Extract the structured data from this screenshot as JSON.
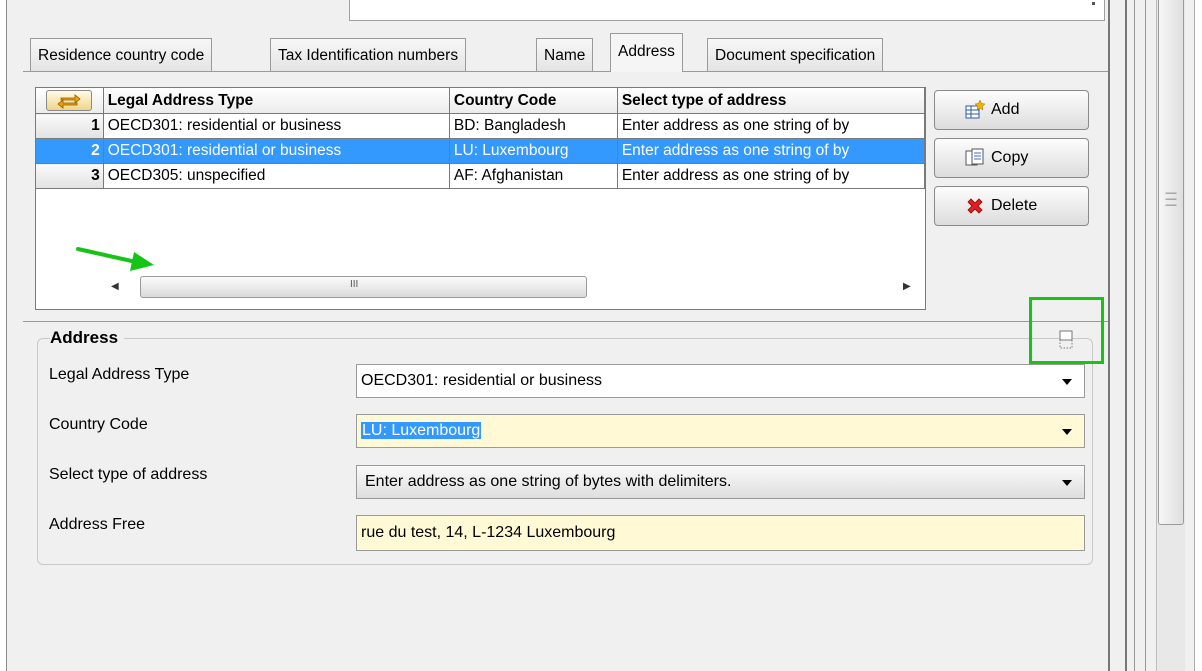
{
  "tabs": [
    {
      "label": "Residence country code"
    },
    {
      "label": "Tax Identification numbers"
    },
    {
      "label": "Name"
    },
    {
      "label": "Address"
    },
    {
      "label": "Document specification"
    }
  ],
  "active_tab": "Address",
  "table": {
    "columns": [
      "Legal Address Type",
      "Country Code",
      "Select type of address"
    ],
    "rows": [
      {
        "num": "1",
        "legal_address_type": "OECD301: residential or business",
        "country_code": "BD: Bangladesh",
        "address_select": "Enter address as one string of by"
      },
      {
        "num": "2",
        "legal_address_type": "OECD301: residential or business",
        "country_code": "LU: Luxembourg",
        "address_select": "Enter address as one string of by"
      },
      {
        "num": "3",
        "legal_address_type": "OECD305: unspecified",
        "country_code": "AF: Afghanistan",
        "address_select": "Enter address as one string of by"
      }
    ],
    "selected_row": 2
  },
  "actions": {
    "add_label": "Add",
    "copy_label": "Copy",
    "delete_label": "Delete"
  },
  "scrollbar": {
    "grip": "III"
  },
  "address_panel": {
    "title": "Address",
    "legal_address_type": {
      "label": "Legal Address Type",
      "value": "OECD301: residential or business"
    },
    "country_code": {
      "label": "Country Code",
      "value": "LU: Luxembourg"
    },
    "address_select": {
      "label": "Select type of address",
      "value": "Enter address as one string of bytes with delimiters."
    },
    "address_free": {
      "label": "Address Free",
      "value": "rue du test, 14, L-1234 Luxembourg"
    }
  },
  "colors": {
    "selection": "#3399ff",
    "required_field": "#fff9d6",
    "annotation_green": "#16c416"
  }
}
